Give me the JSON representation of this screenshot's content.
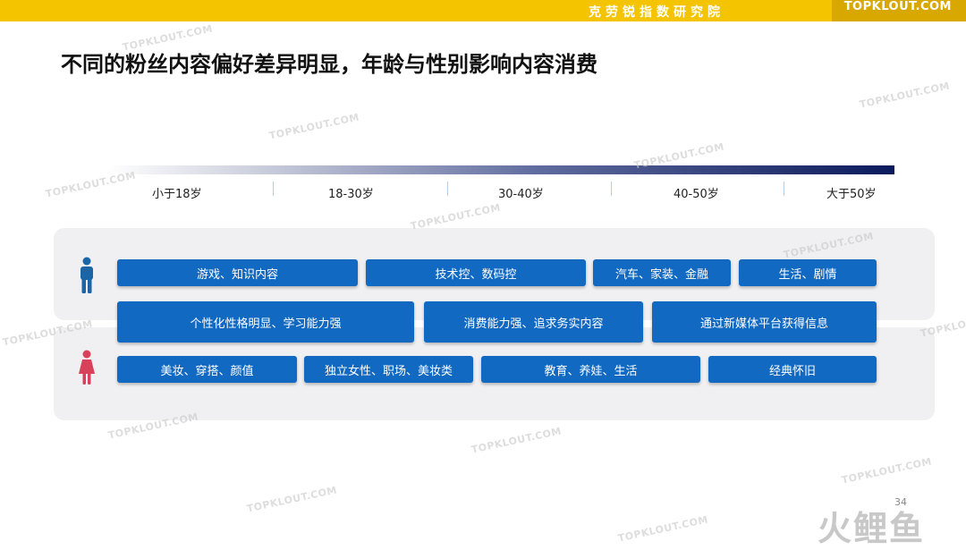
{
  "header": {
    "institute": "克劳锐指数研究院",
    "logo": "TOPKLOUT.COM"
  },
  "title": "不同的粉丝内容偏好差异明显，年龄与性别影响内容消费",
  "age_groups": [
    "小于18岁",
    "18-30岁",
    "30-40岁",
    "40-50岁",
    "大于50岁"
  ],
  "male_row": [
    "游戏、知识内容",
    "技术控、数码控",
    "汽车、家装、金融",
    "生活、剧情"
  ],
  "middle_row": [
    "个性化性格明显、学习能力强",
    "消费能力强、追求务实内容",
    "通过新媒体平台获得信息"
  ],
  "female_row": [
    "美妆、穿搭、颜值",
    "独立女性、职场、美妆类",
    "教育、养娃、生活",
    "经典怀旧"
  ],
  "icons": {
    "male": "male-person-icon",
    "female": "female-person-icon"
  },
  "colors": {
    "chip": "#1269c2",
    "male_icon": "#1b65a6",
    "female_icon": "#d9415a",
    "header": "#f5c400"
  },
  "watermark": "TOPKLOUT.COM",
  "page_number": "34",
  "brand": "火鲤鱼"
}
